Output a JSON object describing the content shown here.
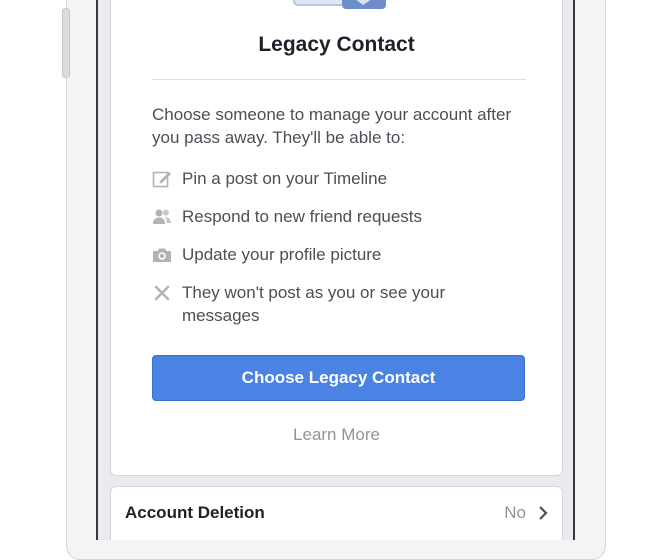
{
  "legacy_contact": {
    "title": "Legacy Contact",
    "description": "Choose someone to manage your account after you pass away. They'll be able to:",
    "permissions": [
      {
        "icon": "edit-icon",
        "text": "Pin a post on your Timeline"
      },
      {
        "icon": "friends-icon",
        "text": "Respond to new friend requests"
      },
      {
        "icon": "camera-icon",
        "text": "Update your profile picture"
      },
      {
        "icon": "x-icon",
        "text": "They won't post as you or see your messages"
      }
    ],
    "choose_button_label": "Choose Legacy Contact",
    "learn_more_label": "Learn More"
  },
  "account_deletion": {
    "label": "Account Deletion",
    "value": "No",
    "chevron_icon": "chevron-right-icon"
  },
  "colors": {
    "accent": "#4a83e4",
    "text_primary": "#1d2129",
    "text_secondary": "#4b4f56",
    "muted": "#90949c"
  }
}
